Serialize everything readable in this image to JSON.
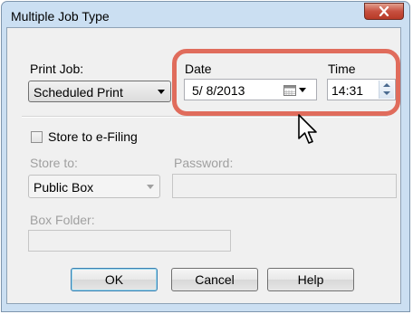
{
  "window": {
    "title": "Multiple Job Type"
  },
  "print_job": {
    "label": "Print Job:",
    "value": "Scheduled Print"
  },
  "date": {
    "label": "Date",
    "value": "5/  8/2013"
  },
  "time": {
    "label": "Time",
    "value": "14:31"
  },
  "store": {
    "checkbox_label": "Store to e-Filing",
    "checked": false,
    "store_to_label": "Store to:",
    "store_to_value": "Public Box",
    "password_label": "Password:",
    "password_value": "",
    "box_folder_label": "Box Folder:",
    "box_folder_value": ""
  },
  "buttons": {
    "ok": "OK",
    "cancel": "Cancel",
    "help": "Help"
  },
  "colors": {
    "highlight": "#e06c5c",
    "close_button": "#c75040"
  }
}
